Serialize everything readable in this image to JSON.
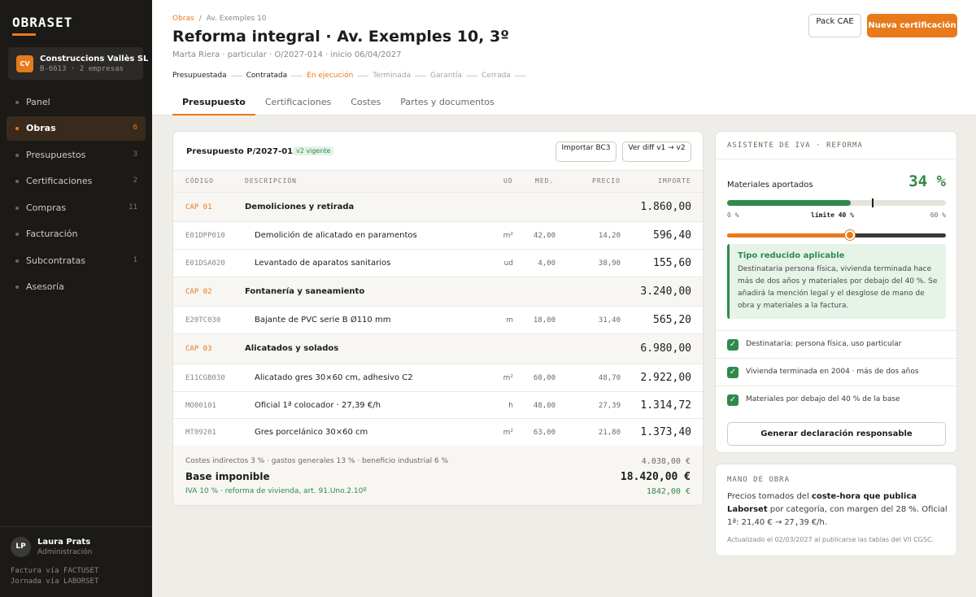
{
  "app": {
    "logo": "OBRASET"
  },
  "company": {
    "badge": "CV",
    "name": "Construccions Vallès SL",
    "sub": "B-6613 · 2 empresas"
  },
  "nav": [
    {
      "label": "Panel",
      "count": ""
    },
    {
      "label": "Obras",
      "count": "6"
    },
    {
      "label": "Presupuestos",
      "count": "3"
    },
    {
      "label": "Certificaciones",
      "count": "2"
    },
    {
      "label": "Compras",
      "count": "11"
    },
    {
      "label": "Facturación",
      "count": ""
    },
    {
      "label": "Subcontratas",
      "count": "1"
    },
    {
      "label": "Asesoría",
      "count": ""
    }
  ],
  "user": {
    "initials": "LP",
    "name": "Laura Prats",
    "role": "Administración"
  },
  "footer": {
    "line1": "Factura vía FACTUSET",
    "line2": "Jornada vía LABORSET"
  },
  "header": {
    "breadcrumb": {
      "root": "Obras",
      "sep": "/",
      "current": "Av. Exemples 10"
    },
    "title": "Reforma integral · Av. Exemples 10, 3º",
    "meta": "Marta Riera · particular · O/2027-014 · inicio 06/04/2027",
    "steps": [
      {
        "label": "Presupuestada",
        "state": "done"
      },
      {
        "label": "Contratada",
        "state": "done"
      },
      {
        "label": "En ejecución",
        "state": "current"
      },
      {
        "label": "Terminada",
        "state": "pending"
      },
      {
        "label": "Garantía",
        "state": "pending"
      },
      {
        "label": "Cerrada",
        "state": "pending"
      }
    ],
    "tabs": [
      "Presupuesto",
      "Certificaciones",
      "Costes",
      "Partes y documentos"
    ],
    "btn_pack": "Pack CAE",
    "btn_new": "Nueva certificación"
  },
  "budget": {
    "title": "Presupuesto P/2027-0141",
    "badge": "v2 vigente",
    "btn_import": "Importar BC3",
    "btn_diff": "Ver diff v1 → v2",
    "columns": {
      "code": "CÓDIGO",
      "desc": "DESCRIPCIÓN",
      "ud": "UD",
      "med": "MED.",
      "precio": "PRECIO",
      "importe": "IMPORTE"
    },
    "rows": [
      {
        "type": "cap",
        "code": "CAP 01",
        "desc": "Demoliciones y retirada",
        "ud": "",
        "med": "",
        "precio": "",
        "importe": "1.860,00"
      },
      {
        "type": "item",
        "code": "E01DPP010",
        "desc": "Demolición de alicatado en paramentos",
        "ud": "m²",
        "med": "42,00",
        "precio": "14,20",
        "importe": "596,40"
      },
      {
        "type": "item",
        "code": "E01DSA020",
        "desc": "Levantado de aparatos sanitarios",
        "ud": "ud",
        "med": "4,00",
        "precio": "38,90",
        "importe": "155,60"
      },
      {
        "type": "cap",
        "code": "CAP 02",
        "desc": "Fontanería y saneamiento",
        "ud": "",
        "med": "",
        "precio": "",
        "importe": "3.240,00"
      },
      {
        "type": "item",
        "code": "E20TC030",
        "desc": "Bajante de PVC serie B Ø110 mm",
        "ud": "m",
        "med": "18,00",
        "precio": "31,40",
        "importe": "565,20"
      },
      {
        "type": "cap",
        "code": "CAP 03",
        "desc": "Alicatados y solados",
        "ud": "",
        "med": "",
        "precio": "",
        "importe": "6.980,00"
      },
      {
        "type": "item",
        "code": "E11CGB030",
        "desc": "Alicatado gres 30×60 cm, adhesivo C2",
        "ud": "m²",
        "med": "60,00",
        "precio": "48,70",
        "importe": "2.922,00"
      },
      {
        "type": "item",
        "code": "MO00101",
        "desc": "Oficial 1ª colocador · 27,39 €/h",
        "ud": "h",
        "med": "48,00",
        "precio": "27,39",
        "importe": "1.314,72"
      },
      {
        "type": "item",
        "code": "MT09201",
        "desc": "Gres porcelánico 30×60 cm",
        "ud": "m²",
        "med": "63,00",
        "precio": "21,80",
        "importe": "1.373,40"
      }
    ],
    "totals": {
      "indirect_label": "Costes indirectos 3 % · gastos generales 13 % · beneficio industrial 6 %",
      "indirect_value": "4.038,00 €",
      "base_label": "Base imponible",
      "base_value": "18.420,00 €",
      "iva_label": "IVA 10 % · reforma de vivienda, art. 91.Uno.2.10º",
      "iva_value": "1842,00 €"
    }
  },
  "iva": {
    "heading": "ASISTENTE DE IVA · REFORMA",
    "materials_label": "Materiales aportados",
    "materials_pct": "34 %",
    "materials_fraction": 0.34,
    "limit_fraction": 0.4,
    "slider_fraction": 0.56,
    "scale_min": "0 %",
    "scale_limit": "límite 40 %",
    "scale_max": "60 %",
    "info_title": "Tipo reducido aplicable",
    "info_text": "Destinataria persona física, vivienda terminada hace más de dos años y materiales por debajo del 40 %. Se añadirá la mención legal y el desglose de mano de obra y materiales a la factura.",
    "checks": [
      "Destinataria: persona física, uso particular",
      "Vivienda terminada en 2004 · más de dos años",
      "Materiales por debajo del 40 % de la base"
    ],
    "btn": "Generar declaración responsable"
  },
  "mano_obra": {
    "heading": "MANO DE OBRA",
    "text_1": "Precios tomados del ",
    "text_bold": "coste-hora que publica Laborset",
    "text_2": " por categoría, con margen del 28 %. Oficial 1ª: 21,40 € → ",
    "text_value": "27,39",
    "text_3": " €/h.",
    "footnote": "Actualizado el 02/03/2027 al publicarse las tablas del VII CGSC."
  },
  "colors": {
    "accent": "#e87a1c",
    "success": "#2f8a4a",
    "sidebar": "#1b1a17"
  }
}
